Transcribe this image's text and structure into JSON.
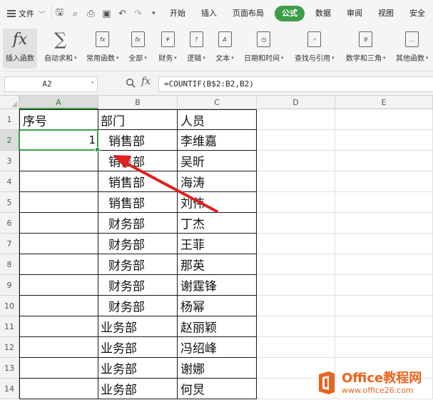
{
  "menubar": {
    "file_label": "文件",
    "tabs": [
      {
        "label": "开始",
        "active": false
      },
      {
        "label": "插入",
        "active": false
      },
      {
        "label": "页面布局",
        "active": false
      },
      {
        "label": "公式",
        "active": true
      },
      {
        "label": "数据",
        "active": false
      },
      {
        "label": "审阅",
        "active": false
      },
      {
        "label": "视图",
        "active": false
      },
      {
        "label": "安全",
        "active": false
      }
    ]
  },
  "ribbon": {
    "buttons": [
      {
        "label": "插入函数",
        "icon": "fx-icon",
        "glyph": "fx",
        "dropdown": false
      },
      {
        "label": "自动求和",
        "icon": "sigma-icon",
        "glyph": "∑",
        "dropdown": true
      },
      {
        "label": "常用函数",
        "icon": "common-functions-icon",
        "glyph": "fx",
        "dropdown": true
      },
      {
        "label": "全部",
        "icon": "all-functions-icon",
        "glyph": "fx",
        "dropdown": true
      },
      {
        "label": "财务",
        "icon": "finance-icon",
        "glyph": "¥",
        "dropdown": true
      },
      {
        "label": "逻辑",
        "icon": "logic-icon",
        "glyph": "?",
        "dropdown": true
      },
      {
        "label": "文本",
        "icon": "text-icon",
        "glyph": "A",
        "dropdown": true
      },
      {
        "label": "日期和时间",
        "icon": "datetime-icon",
        "glyph": "◷",
        "dropdown": true
      },
      {
        "label": "查找与引用",
        "icon": "lookup-icon",
        "glyph": "⌕",
        "dropdown": true
      },
      {
        "label": "数学和三角",
        "icon": "math-icon",
        "glyph": "θ",
        "dropdown": true
      },
      {
        "label": "其他函数",
        "icon": "other-functions-icon",
        "glyph": "…",
        "dropdown": true
      }
    ]
  },
  "formula_bar": {
    "cell_ref": "A2",
    "formula": "=COUNTIF(B$2:B2,B2)"
  },
  "sheet": {
    "columns": [
      "A",
      "B",
      "C",
      "D",
      "E"
    ],
    "selected_column": "A",
    "selected_row": "2",
    "rows": [
      {
        "n": "1",
        "a": "序号",
        "b": "部门",
        "c": "人员"
      },
      {
        "n": "2",
        "a": "1",
        "b": "销售部",
        "c": "李维嘉"
      },
      {
        "n": "3",
        "a": "",
        "b": "销售部",
        "c": "吴昕"
      },
      {
        "n": "4",
        "a": "",
        "b": "销售部",
        "c": "海涛"
      },
      {
        "n": "5",
        "a": "",
        "b": "销售部",
        "c": "刘伟"
      },
      {
        "n": "6",
        "a": "",
        "b": "财务部",
        "c": "丁杰"
      },
      {
        "n": "7",
        "a": "",
        "b": "财务部",
        "c": "王菲"
      },
      {
        "n": "8",
        "a": "",
        "b": "财务部",
        "c": "那英"
      },
      {
        "n": "9",
        "a": "",
        "b": "财务部",
        "c": "谢霆锋"
      },
      {
        "n": "10",
        "a": "",
        "b": "财务部",
        "c": "杨幂"
      },
      {
        "n": "11",
        "a": "",
        "b": "业务部",
        "c": "赵丽颖"
      },
      {
        "n": "12",
        "a": "",
        "b": "业务部",
        "c": "冯绍峰"
      },
      {
        "n": "13",
        "a": "",
        "b": "业务部",
        "c": "谢娜"
      },
      {
        "n": "14",
        "a": "",
        "b": "业务部",
        "c": "何炅"
      }
    ]
  },
  "watermark": {
    "line1": "Office教程网",
    "line2": "www.office26.com"
  },
  "colors": {
    "accent_green": "#3e9e48",
    "arrow_red": "#e02020",
    "watermark_orange": "#e8651f"
  }
}
